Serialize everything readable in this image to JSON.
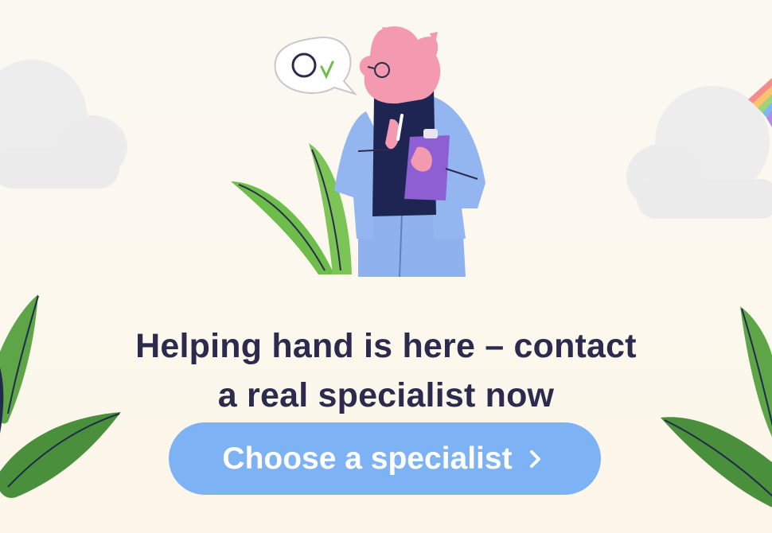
{
  "promo": {
    "headline_line1": "Helping hand is here – contact",
    "headline_line2": "a real specialist now",
    "cta_label": "Choose a specialist",
    "cta_icon": "chevron-right-icon"
  },
  "illustration": {
    "speech_bubble_text": "Ov",
    "character": "pig-specialist-with-clipboard",
    "decorations": [
      "cloud",
      "cloud",
      "rainbow",
      "plant-leaves"
    ]
  },
  "colors": {
    "headline": "#2c2b4e",
    "cta_background": "#7db2f5",
    "cta_text": "#ffffff",
    "leaf_green": "#6dbd4a",
    "leaf_dark": "#1e2b4a",
    "pig_pink": "#f39ab0",
    "coat_blue": "#8fb2ee",
    "clipboard_purple": "#8d5fd3"
  }
}
